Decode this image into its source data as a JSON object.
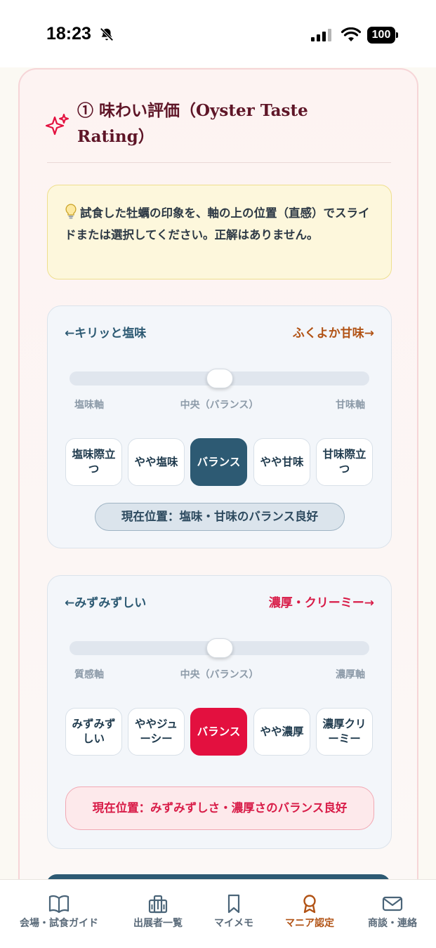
{
  "status_bar": {
    "time": "18:23",
    "battery": "100",
    "icons": [
      "bell-slash-icon",
      "signal-icon",
      "wifi-icon",
      "battery-icon"
    ]
  },
  "section": {
    "icon": "sparkle-icon",
    "title": "① 味わい評価（Oyster Taste Rating）",
    "hint_icon": "lightbulb-icon",
    "hint": "試食した牡蠣の印象を、軸の上の位置（直感）でスライドまたは選択してください。正解はありません。"
  },
  "axes": [
    {
      "left_label": "←キリッと塩味",
      "right_label": "ふくよか甘味→",
      "ticks": [
        "塩味軸",
        "中央（バランス）",
        "甘味軸"
      ],
      "slider_value": 0.5,
      "options": [
        "塩味際立つ",
        "やや塩味",
        "バランス",
        "やや甘味",
        "甘味際立つ"
      ],
      "selected_index": 2,
      "status": "現在位置：塩味・甘味のバランス良好"
    },
    {
      "left_label": "←みずみずしい",
      "right_label": "濃厚・クリーミー→",
      "ticks": [
        "質感軸",
        "中央（バランス）",
        "濃厚軸"
      ],
      "slider_value": 0.5,
      "options": [
        "みずみずしい",
        "ややジューシー",
        "バランス",
        "やや濃厚",
        "濃厚クリーミー"
      ],
      "selected_index": 2,
      "status": "現在位置：みずみずしさ・濃厚さのバランス良好"
    }
  ],
  "colors": {
    "accent_blue": "#2d5a73",
    "accent_red": "#e3103f",
    "accent_orange": "#b15214",
    "title": "#5e1527"
  },
  "tab_bar": {
    "active_index": 3,
    "tabs": [
      {
        "label": "会場・試食ガイド",
        "icon": "book-icon"
      },
      {
        "label": "出展者一覧",
        "icon": "building-icon"
      },
      {
        "label": "マイメモ",
        "icon": "bookmark-icon"
      },
      {
        "label": "マニア認定",
        "icon": "award-icon"
      },
      {
        "label": "商談・連絡",
        "icon": "mail-icon"
      }
    ]
  }
}
